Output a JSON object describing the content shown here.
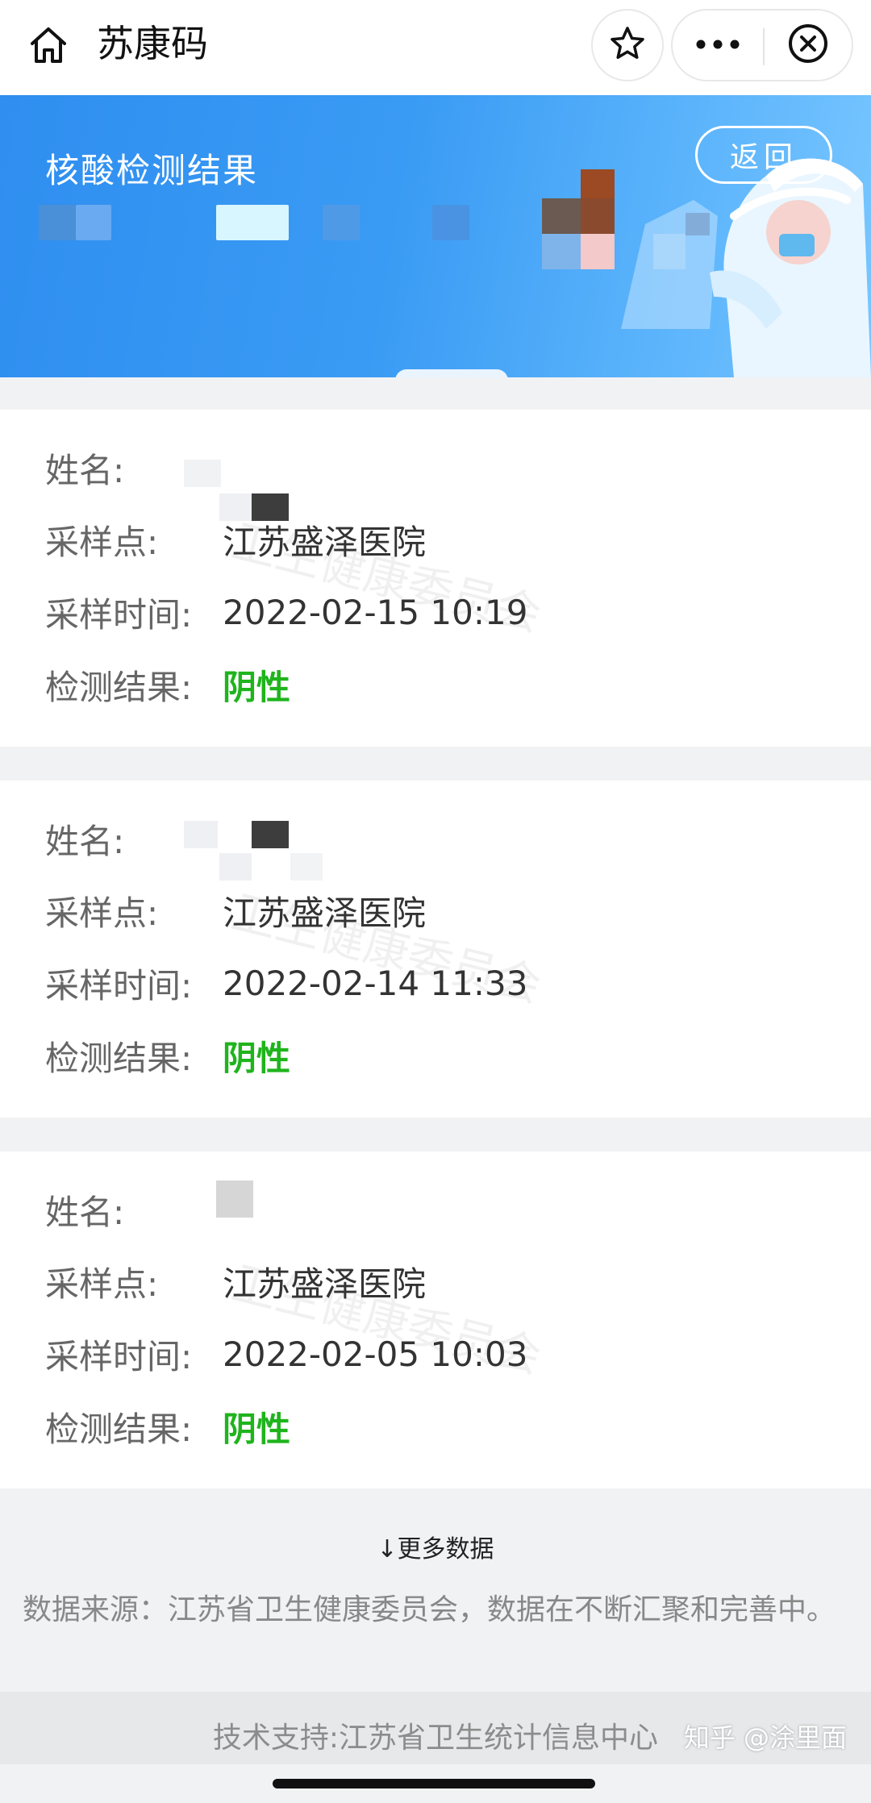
{
  "topbar": {
    "title": "苏康码",
    "icons": [
      "home-icon",
      "star-icon",
      "more-icon",
      "close-icon"
    ]
  },
  "banner": {
    "title": "核酸检测结果",
    "back_label": "返回",
    "color": "#3a9bf4"
  },
  "labels": {
    "name": "姓名:",
    "site": "采样点:",
    "time": "采样时间:",
    "result": "检测结果:"
  },
  "watermark": "卫生健康委员会",
  "records": [
    {
      "site": "江苏盛泽医院",
      "time": "2022-02-15 10:19",
      "result": "阴性"
    },
    {
      "site": "江苏盛泽医院",
      "time": "2022-02-14 11:33",
      "result": "阴性"
    },
    {
      "site": "江苏盛泽医院",
      "time": "2022-02-05 10:03",
      "result": "阴性"
    }
  ],
  "result_color": "#1fb41c",
  "footer": {
    "more_data": "↓更多数据",
    "source": "数据来源：江苏省卫生健康委员会，数据在不断汇聚和完善中。",
    "tech_support": "技术支持:江苏省卫生统计信息中心",
    "attribution": "知乎 @涂里面"
  }
}
